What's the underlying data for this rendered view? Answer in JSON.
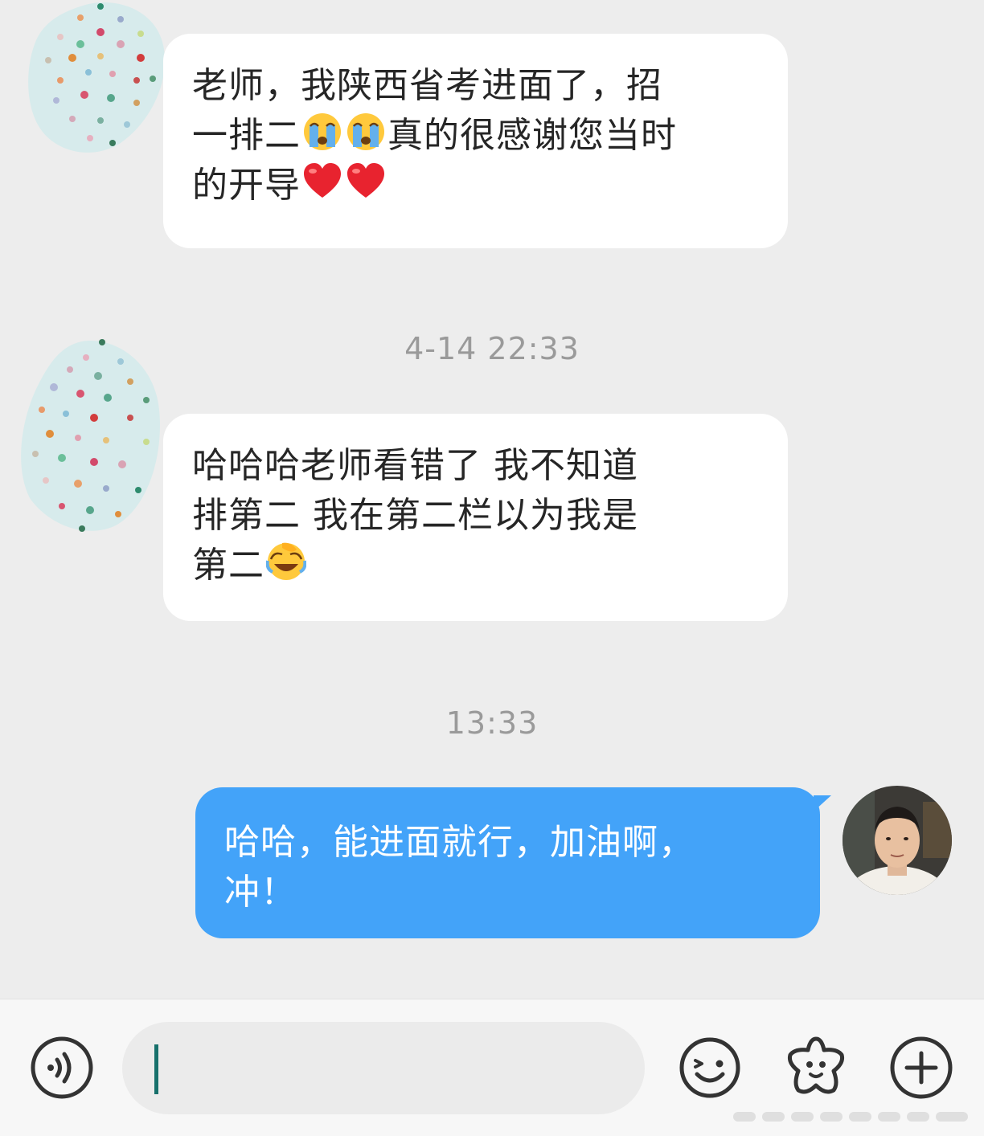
{
  "messages": [
    {
      "side": "incoming",
      "line1": "老师，我陕西省考进面了，招",
      "line2a": "一排二",
      "line2b": "真的很感谢您当时",
      "line3a": "的开导"
    },
    {
      "side": "incoming",
      "line1": "哈哈哈老师看错了 我不知道",
      "line2": "排第二 我在第二栏以为我是",
      "line3a": "第二"
    },
    {
      "side": "outgoing",
      "line1": "哈哈，能进面就行，加油啊，",
      "line2": "冲！"
    }
  ],
  "timestamps": {
    "first": "4-14 22:33",
    "second": "13:33"
  },
  "emojis": {
    "crying": "loudly-crying-face",
    "heart": "red-heart",
    "facepalm": "face-with-tears-of-joy-covering"
  },
  "input": {
    "value": "",
    "placeholder": ""
  },
  "colors": {
    "background": "#ededed",
    "incoming_bubble": "#ffffff",
    "outgoing_bubble": "#43a3f9",
    "timestamp": "#9a9a9a",
    "caret": "#17706b"
  }
}
